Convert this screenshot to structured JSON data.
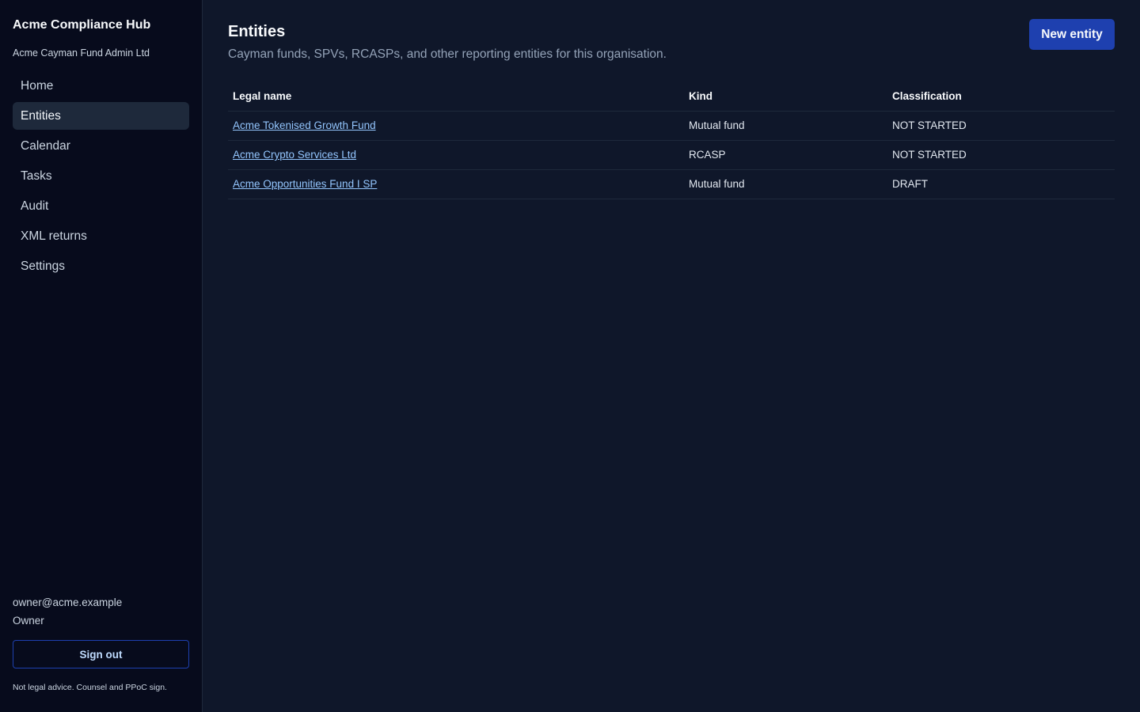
{
  "sidebar": {
    "brand_title": "Acme Compliance Hub",
    "org_name": "Acme Cayman Fund Admin Ltd",
    "nav": [
      {
        "label": "Home",
        "active": false
      },
      {
        "label": "Entities",
        "active": true
      },
      {
        "label": "Calendar",
        "active": false
      },
      {
        "label": "Tasks",
        "active": false
      },
      {
        "label": "Audit",
        "active": false
      },
      {
        "label": "XML returns",
        "active": false
      },
      {
        "label": "Settings",
        "active": false
      }
    ],
    "user_email": "owner@acme.example",
    "user_role": "Owner",
    "signout_label": "Sign out",
    "disclaimer": "Not legal advice. Counsel and PPoC sign."
  },
  "main": {
    "title": "Entities",
    "subtitle": "Cayman funds, SPVs, RCASPs, and other reporting entities for this organisation.",
    "new_button_label": "New entity",
    "table": {
      "headers": [
        "Legal name",
        "Kind",
        "Classification"
      ],
      "rows": [
        {
          "legal_name": "Acme Tokenised Growth Fund",
          "kind": "Mutual fund",
          "classification": "NOT STARTED"
        },
        {
          "legal_name": "Acme Crypto Services Ltd",
          "kind": "RCASP",
          "classification": "NOT STARTED"
        },
        {
          "legal_name": "Acme Opportunities Fund I SP",
          "kind": "Mutual fund",
          "classification": "DRAFT"
        }
      ]
    }
  },
  "colors": {
    "background": "#0f172a",
    "sidebar_background": "#070b1c",
    "accent": "#1e40af",
    "link": "#93c5fd"
  }
}
